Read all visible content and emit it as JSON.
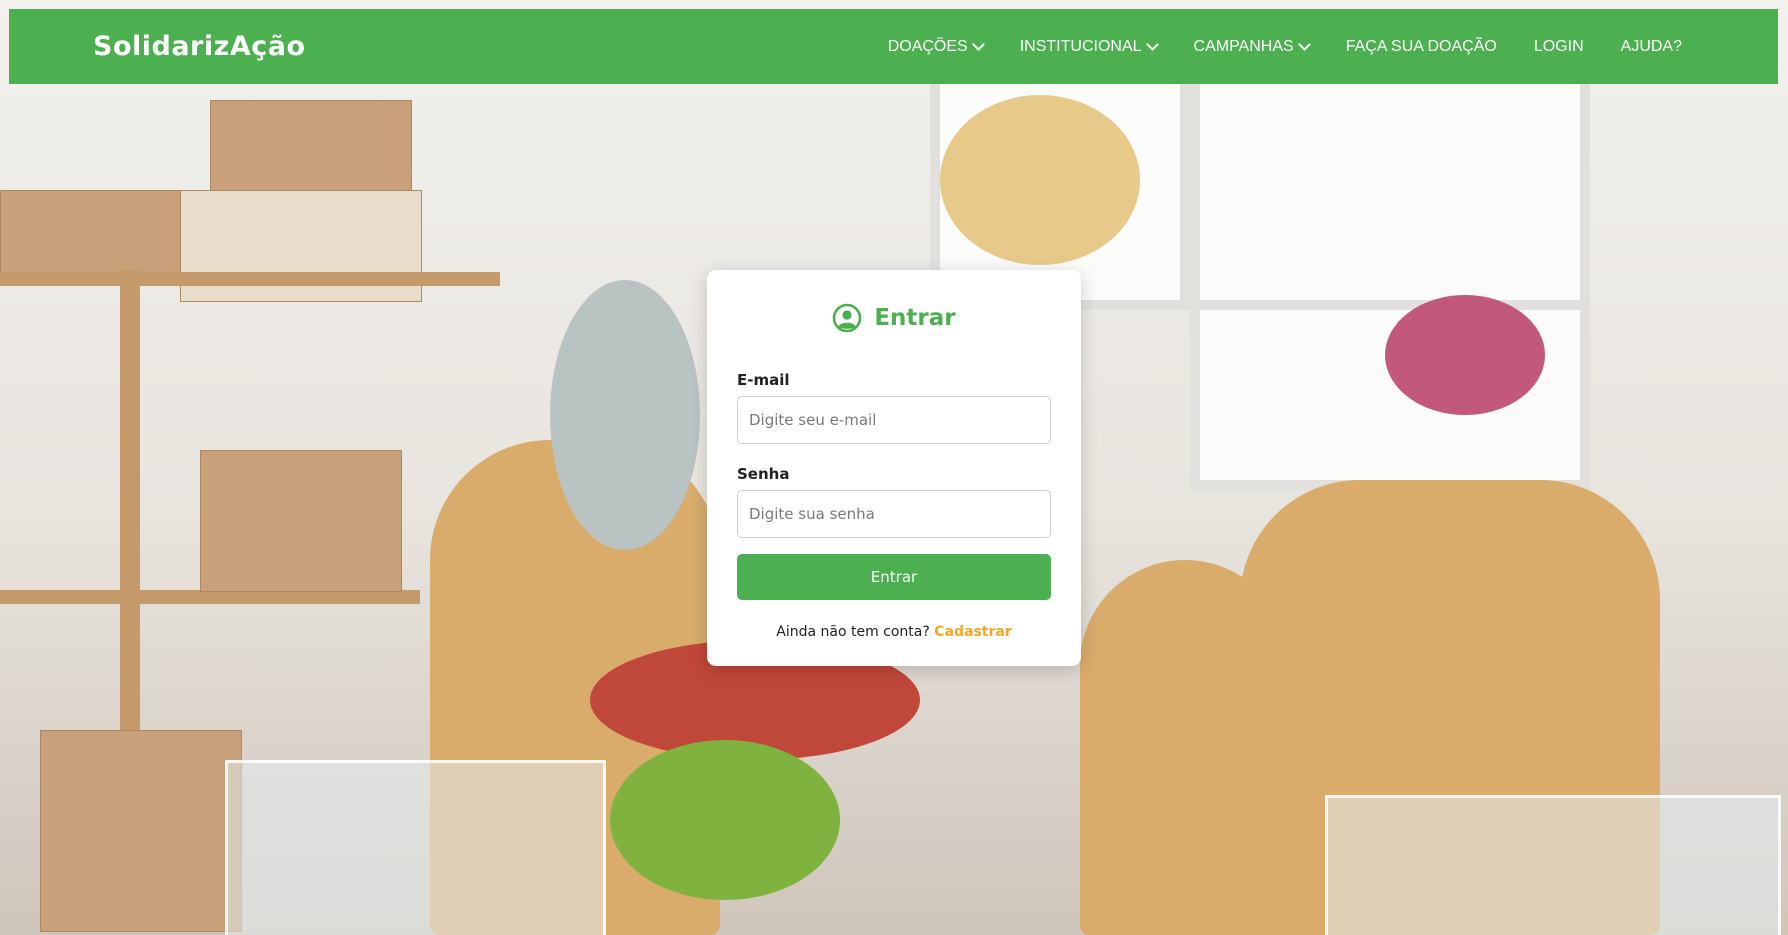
{
  "brand": "SolidarizAção",
  "nav": {
    "items": [
      {
        "label": "DOAÇÕES",
        "dropdown": true
      },
      {
        "label": "INSTITUCIONAL",
        "dropdown": true
      },
      {
        "label": "CAMPANHAS",
        "dropdown": true
      },
      {
        "label": "FAÇA SUA DOAÇÃO",
        "dropdown": false
      },
      {
        "label": "LOGIN",
        "dropdown": false
      },
      {
        "label": "AJUDA?",
        "dropdown": false
      }
    ]
  },
  "login": {
    "title": "Entrar",
    "title_icon": "user-circle-icon",
    "email_label": "E-mail",
    "email_placeholder": "Digite seu e-mail",
    "email_value": "",
    "password_label": "Senha",
    "password_placeholder": "Digite sua senha",
    "password_value": "",
    "submit_label": "Entrar",
    "signup_prompt": "Ainda não tem conta?",
    "signup_link": "Cadastrar"
  },
  "colors": {
    "primary": "#4caf50",
    "accent": "#f5a623",
    "text": "#222222"
  }
}
